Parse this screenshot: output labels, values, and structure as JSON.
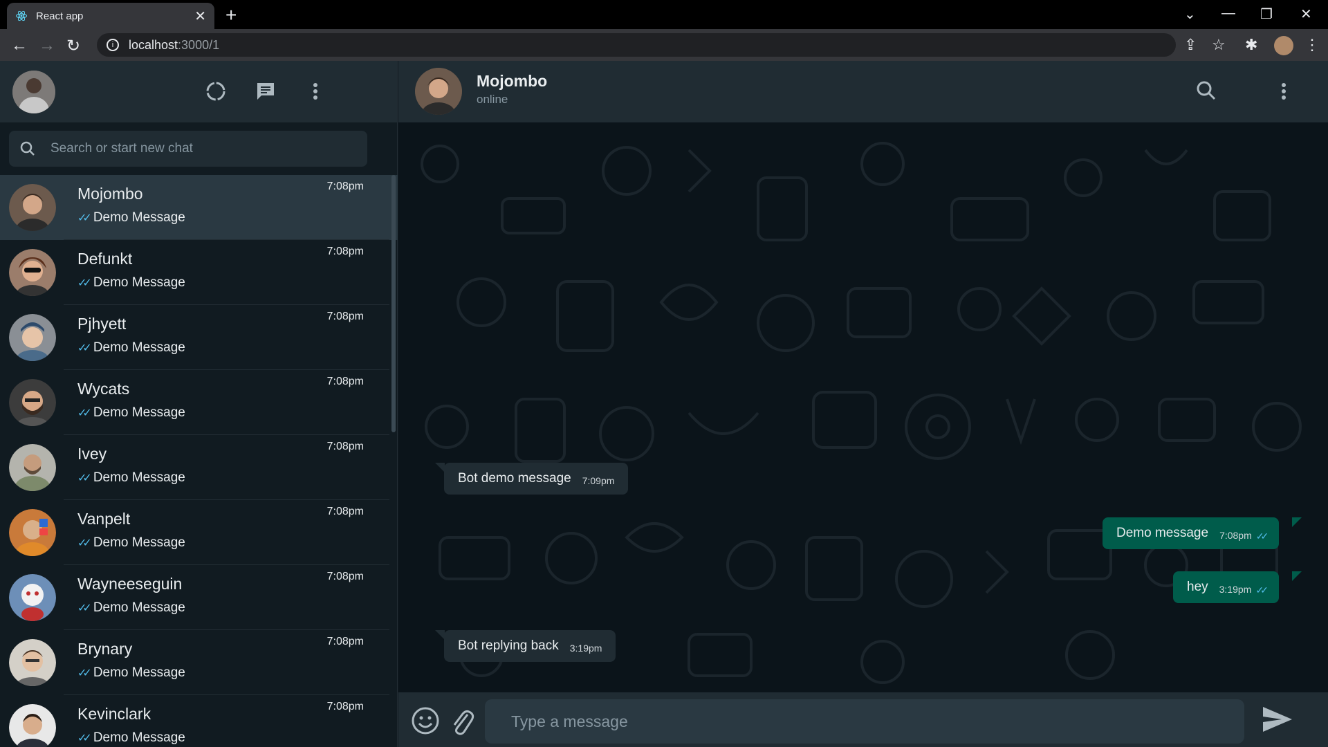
{
  "browser": {
    "tab_title": "React app",
    "url_host": "localhost",
    "url_path": ":3000/1"
  },
  "sidebar": {
    "search_placeholder": "Search or start new chat",
    "chats": [
      {
        "name": "Mojombo",
        "time": "7:08pm",
        "last": "Demo Message",
        "active": true
      },
      {
        "name": "Defunkt",
        "time": "7:08pm",
        "last": "Demo Message"
      },
      {
        "name": "Pjhyett",
        "time": "7:08pm",
        "last": "Demo Message"
      },
      {
        "name": "Wycats",
        "time": "7:08pm",
        "last": "Demo Message"
      },
      {
        "name": "Ivey",
        "time": "7:08pm",
        "last": "Demo Message"
      },
      {
        "name": "Vanpelt",
        "time": "7:08pm",
        "last": "Demo Message"
      },
      {
        "name": "Wayneeseguin",
        "time": "7:08pm",
        "last": "Demo Message"
      },
      {
        "name": "Brynary",
        "time": "7:08pm",
        "last": "Demo Message"
      },
      {
        "name": "Kevinclark",
        "time": "7:08pm",
        "last": "Demo Message"
      }
    ]
  },
  "conversation": {
    "name": "Mojombo",
    "status": "online",
    "messages": [
      {
        "text": "Bot demo message",
        "time": "7:09pm",
        "dir": "in"
      },
      {
        "text": "Demo message",
        "time": "7:08pm",
        "dir": "out"
      },
      {
        "text": "hey",
        "time": "3:19pm",
        "dir": "out"
      },
      {
        "text": "Bot replying back",
        "time": "3:19pm",
        "dir": "in"
      }
    ],
    "composer_placeholder": "Type a message"
  },
  "colors": {
    "incoming_bubble": "#202c33",
    "outgoing_bubble": "#005c4b",
    "read_tick": "#53bdeb",
    "panel": "#202c33",
    "background": "#111b21"
  },
  "icons": {
    "header": [
      "status-icon",
      "new-chat-icon",
      "menu-icon"
    ],
    "conversation_header": [
      "search-icon",
      "menu-icon"
    ],
    "composer": [
      "emoji-icon",
      "attach-icon",
      "send-icon"
    ]
  }
}
